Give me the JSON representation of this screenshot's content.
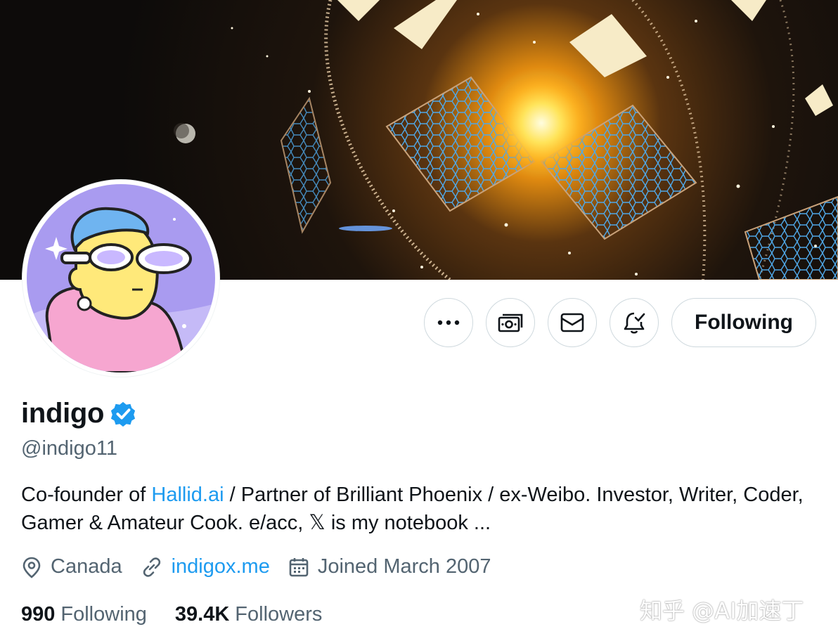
{
  "profile": {
    "name": "indigo",
    "handle": "@indigo11",
    "bio": {
      "part1": "Co-founder of ",
      "link": "Hallid.ai",
      "part2": " / Partner of Brilliant Phoenix / ex-Weibo. Investor, Writer, Coder, Gamer & Amateur Cook. e/acc, ",
      "x_glyph": "𝕏",
      "part3": " is my notebook ..."
    },
    "location": "Canada",
    "website": "indigox.me",
    "joined": "Joined March 2007",
    "following_count": "990",
    "following_label": "Following",
    "followers_count": "39.4K",
    "followers_label": "Followers"
  },
  "actions": {
    "more_icon": "more-dots-icon",
    "subscribe_icon": "money-icon",
    "message_icon": "envelope-icon",
    "notify_icon": "bell-check-icon",
    "follow_label": "Following"
  },
  "watermark": "知乎 @AI加速丁",
  "colors": {
    "accent": "#1d9bf0",
    "secondary_text": "#536471",
    "primary_text": "#0f1419",
    "border": "#cfd9de"
  }
}
